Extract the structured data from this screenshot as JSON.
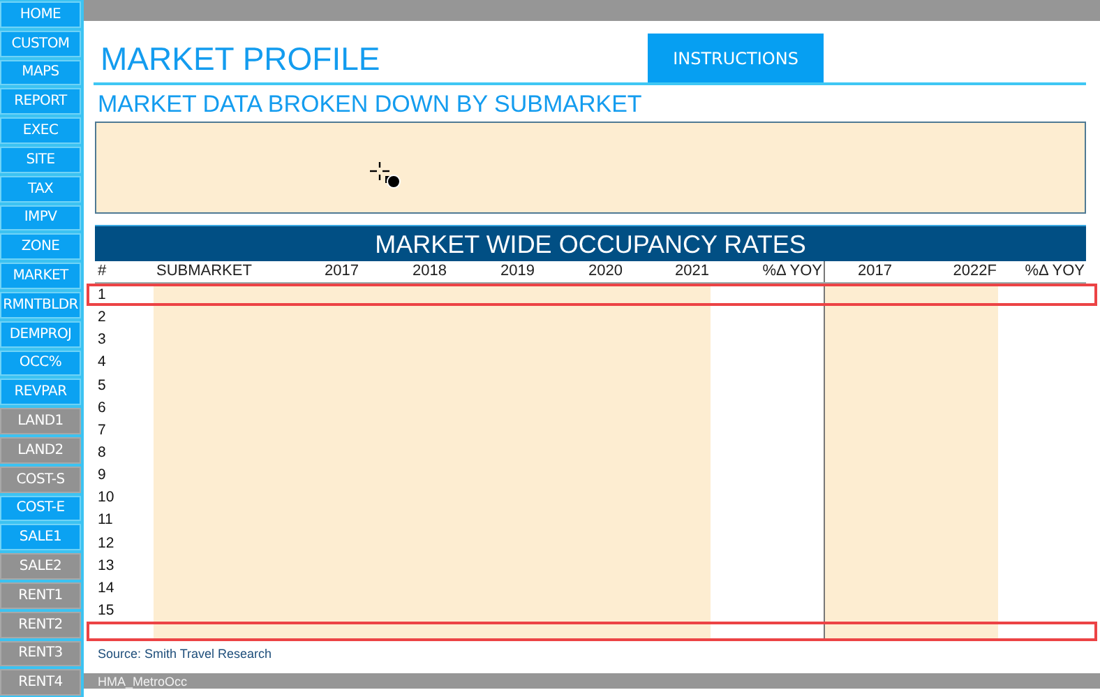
{
  "sidebar": {
    "items": [
      {
        "label": "HOME",
        "active": true
      },
      {
        "label": "CUSTOM",
        "active": true
      },
      {
        "label": "MAPS",
        "active": true
      },
      {
        "label": "REPORT",
        "active": true
      },
      {
        "label": "EXEC",
        "active": true
      },
      {
        "label": "SITE",
        "active": true
      },
      {
        "label": "TAX",
        "active": true
      },
      {
        "label": "IMPV",
        "active": true
      },
      {
        "label": "ZONE",
        "active": true
      },
      {
        "label": "MARKET",
        "active": true
      },
      {
        "label": "RMNTBLDR",
        "active": true
      },
      {
        "label": "DEMPROJ",
        "active": true
      },
      {
        "label": "OCC%",
        "active": true
      },
      {
        "label": "REVPAR",
        "active": true
      },
      {
        "label": "LAND1",
        "active": false
      },
      {
        "label": "LAND2",
        "active": false
      },
      {
        "label": "COST-S",
        "active": false
      },
      {
        "label": "COST-E",
        "active": true
      },
      {
        "label": "SALE1",
        "active": true
      },
      {
        "label": "SALE2",
        "active": false
      },
      {
        "label": "RENT1",
        "active": false
      },
      {
        "label": "RENT2",
        "active": false
      },
      {
        "label": "RENT3",
        "active": false
      },
      {
        "label": "RENT4",
        "active": false
      }
    ]
  },
  "title": "MARKET PROFILE",
  "instructions_button": "INSTRUCTIONS",
  "subtitle": "MARKET DATA BROKEN DOWN BY SUBMARKET",
  "table": {
    "title": "MARKET WIDE OCCUPANCY RATES",
    "columns": [
      {
        "label": "#",
        "shaded": false
      },
      {
        "label": "SUBMARKET",
        "shaded": true
      },
      {
        "label": "2017",
        "shaded": true
      },
      {
        "label": "2018",
        "shaded": true
      },
      {
        "label": "2019",
        "shaded": true
      },
      {
        "label": "2020",
        "shaded": true
      },
      {
        "label": "2021",
        "shaded": true
      },
      {
        "label": "%Δ YOY",
        "shaded": false
      },
      {
        "label": "2017",
        "shaded": true
      },
      {
        "label": "2022F",
        "shaded": true
      },
      {
        "label": "%Δ YOY",
        "shaded": false
      }
    ],
    "rows": [
      {
        "number": "1",
        "highlighted": true
      },
      {
        "number": "2",
        "highlighted": false
      },
      {
        "number": "3",
        "highlighted": false
      },
      {
        "number": "4",
        "highlighted": false
      },
      {
        "number": "5",
        "highlighted": false
      },
      {
        "number": "6",
        "highlighted": false
      },
      {
        "number": "7",
        "highlighted": false
      },
      {
        "number": "8",
        "highlighted": false
      },
      {
        "number": "9",
        "highlighted": false
      },
      {
        "number": "10",
        "highlighted": false
      },
      {
        "number": "11",
        "highlighted": false
      },
      {
        "number": "12",
        "highlighted": false
      },
      {
        "number": "13",
        "highlighted": false
      },
      {
        "number": "14",
        "highlighted": false
      },
      {
        "number": "15",
        "highlighted": false
      }
    ],
    "footer_row": {
      "highlighted": true
    }
  },
  "source": "Source: Smith Travel Research",
  "sheet_tab": "HMA_MetroOcc"
}
